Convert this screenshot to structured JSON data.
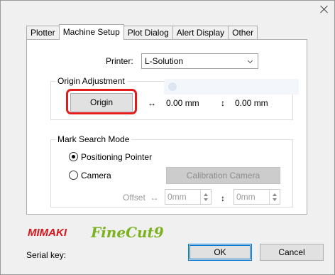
{
  "window": {
    "close_icon": "close-icon"
  },
  "tabs": [
    {
      "label": "Plotter",
      "active": false
    },
    {
      "label": "Machine Setup",
      "active": true
    },
    {
      "label": "Plot Dialog",
      "active": false
    },
    {
      "label": "Alert Display",
      "active": false
    },
    {
      "label": "Other",
      "active": false
    }
  ],
  "printer": {
    "label": "Printer:",
    "selected": "L-Solution",
    "dropdown_icon": "chevron-down-icon"
  },
  "origin_adjustment": {
    "title": "Origin Adjustment",
    "button_label": "Origin",
    "x_symbol": "↔",
    "x_value": "0.00 mm",
    "y_symbol": "↕",
    "y_value": "0.00 mm",
    "highlight_color": "#e21b1b"
  },
  "mark_search_mode": {
    "title": "Mark Search Mode",
    "options": [
      {
        "label": "Positioning Pointer",
        "checked": true
      },
      {
        "label": "Camera",
        "checked": false
      }
    ],
    "calibration_button": "Calibration Camera",
    "offset_label": "Offset",
    "offset_x_symbol": "↔",
    "offset_x_value": "0mm",
    "offset_y_symbol": "↕",
    "offset_y_value": "0mm"
  },
  "branding": {
    "mimaki": "MIMAKI",
    "mimaki_color": "#d4151c",
    "finecut": "FineCut9",
    "finecut_color": "#7cb11f"
  },
  "footer": {
    "serial_label": "Serial key:",
    "ok_label": "OK",
    "cancel_label": "Cancel"
  }
}
